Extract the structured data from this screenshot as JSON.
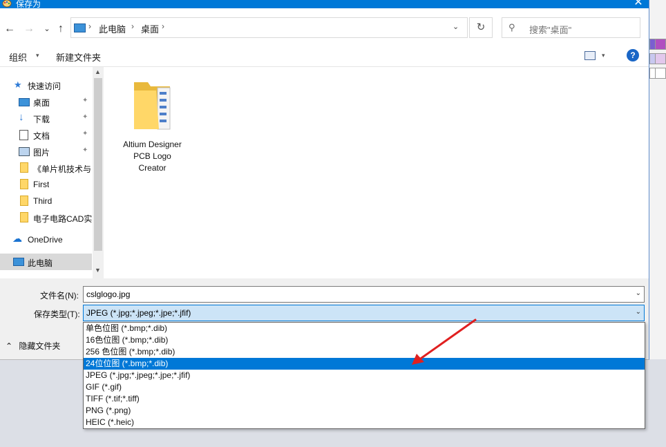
{
  "window": {
    "title": "保存为",
    "close_symbol": "✕"
  },
  "nav": {
    "back_symbol": "←",
    "forward_symbol": "→",
    "recent_symbol": "⌄",
    "up_symbol": "↑",
    "breadcrumbs": [
      "此电脑",
      "桌面"
    ],
    "breadcrumb_separator": "›",
    "address_dropdown": "⌄",
    "refresh_symbol": "↻",
    "search_placeholder": "搜索\"桌面\"",
    "search_symbol": "⚲"
  },
  "toolbar": {
    "organize_label": "组织",
    "organize_caret": "▾",
    "new_folder_label": "新建文件夹",
    "view_caret": "▾",
    "help_symbol": "?"
  },
  "sidebar": {
    "items": [
      {
        "label": "快速访问",
        "icon": "star-icon",
        "pinned": false,
        "selected": false
      },
      {
        "label": "桌面",
        "icon": "desktop-icon",
        "pinned": true,
        "selected": false
      },
      {
        "label": "下载",
        "icon": "download-icon",
        "pinned": true,
        "selected": false
      },
      {
        "label": "文档",
        "icon": "document-icon",
        "pinned": true,
        "selected": false
      },
      {
        "label": "图片",
        "icon": "picture-icon",
        "pinned": true,
        "selected": false
      },
      {
        "label": "《单片机技术与",
        "icon": "folder-icon",
        "pinned": false,
        "selected": false
      },
      {
        "label": "First",
        "icon": "folder-icon",
        "pinned": false,
        "selected": false
      },
      {
        "label": "Third",
        "icon": "folder-icon",
        "pinned": false,
        "selected": false
      },
      {
        "label": "电子电路CAD实",
        "icon": "folder-icon",
        "pinned": false,
        "selected": false
      },
      {
        "label": "OneDrive",
        "icon": "cloud-icon",
        "pinned": false,
        "selected": false
      },
      {
        "label": "此电脑",
        "icon": "computer-icon",
        "pinned": false,
        "selected": true
      }
    ],
    "pin_symbol": "📌"
  },
  "files": [
    {
      "name_lines": [
        "Altium Designer",
        "PCB Logo",
        "Creator"
      ],
      "icon": "folder-icon"
    }
  ],
  "form": {
    "filename_label": "文件名(N):",
    "filename_value": "cslglogo.jpg",
    "filetype_label": "保存类型(T):",
    "filetype_value": "JPEG (*.jpg;*.jpeg;*.jpe;*.jfif)",
    "combo_caret": "⌄",
    "hide_folders_label": "隐藏文件夹",
    "hide_folders_caret": "⌃"
  },
  "dropdown": {
    "options": [
      "单色位图 (*.bmp;*.dib)",
      "16色位图 (*.bmp;*.dib)",
      "256 色位图 (*.bmp;*.dib)",
      "24位位图 (*.bmp;*.dib)",
      "JPEG (*.jpg;*.jpeg;*.jpe;*.jfif)",
      "GIF (*.gif)",
      "TIFF (*.tif;*.tiff)",
      "PNG (*.png)",
      "HEIC (*.heic)"
    ],
    "selected_index": 3
  },
  "colors": {
    "accent": "#0078d7",
    "selected_bg": "#0078d7",
    "annotation_arrow": "#e02020"
  }
}
